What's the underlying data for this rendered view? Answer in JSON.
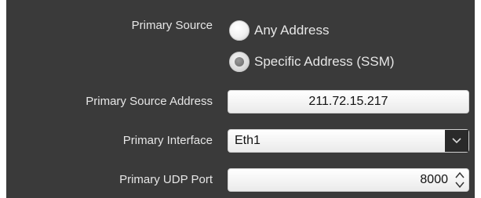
{
  "primary_source": {
    "label": "Primary Source",
    "options": [
      {
        "label": "Any Address",
        "selected": false
      },
      {
        "label": "Specific Address (SSM)",
        "selected": true
      }
    ]
  },
  "primary_source_address": {
    "label": "Primary Source Address",
    "value": "211.72.15.217"
  },
  "primary_interface": {
    "label": "Primary Interface",
    "value": "Eth1"
  },
  "primary_udp_port": {
    "label": "Primary UDP Port",
    "value": "8000"
  },
  "colors": {
    "panel_bg": "#3a3a3a",
    "label_text": "#e6e6e6",
    "field_bg": "#ffffff"
  },
  "icons": {
    "dropdown": "chevron-down-icon",
    "spinner": "spinner-arrows-icon"
  }
}
